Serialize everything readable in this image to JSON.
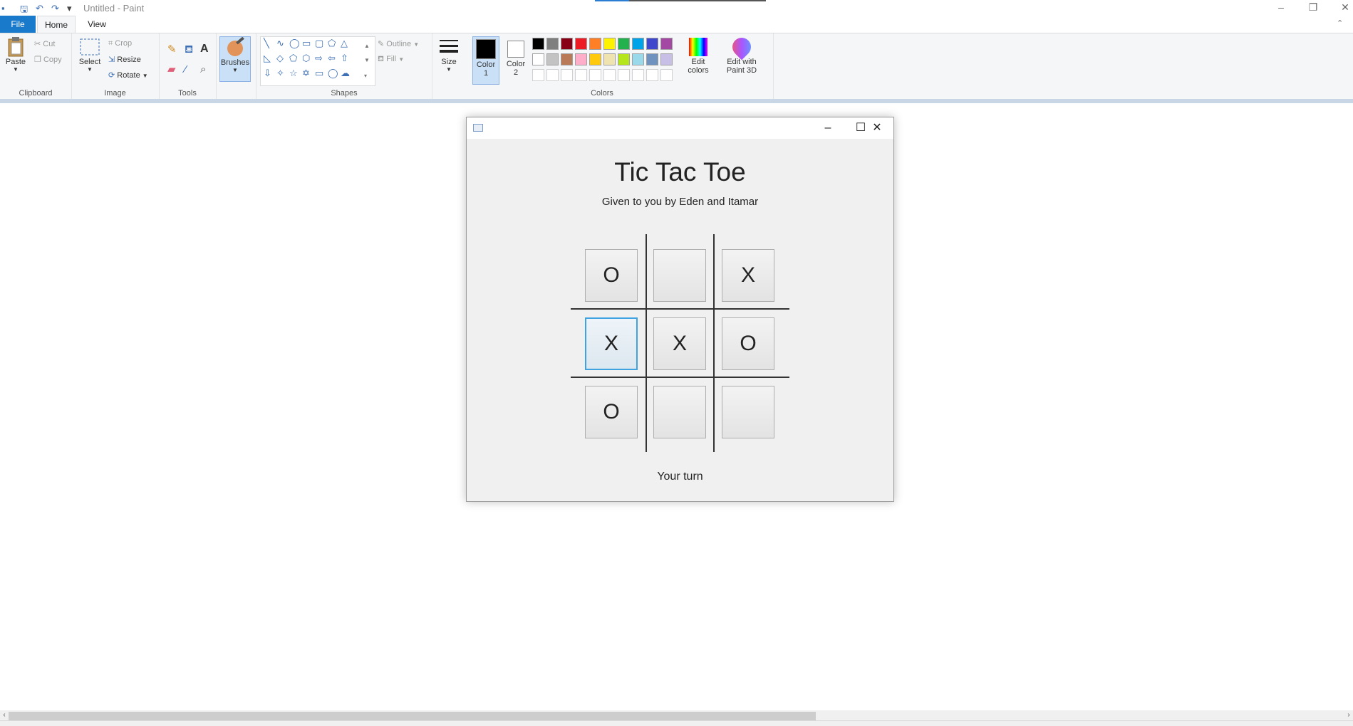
{
  "window": {
    "title": "Untitled - Paint"
  },
  "tabs": {
    "file": "File",
    "home": "Home",
    "view": "View"
  },
  "clipboard": {
    "paste": "Paste",
    "cut": "Cut",
    "copy": "Copy",
    "label": "Clipboard"
  },
  "image": {
    "select": "Select",
    "crop": "Crop",
    "resize": "Resize",
    "rotate": "Rotate",
    "label": "Image"
  },
  "tools": {
    "label": "Tools"
  },
  "brushes": {
    "label": "Brushes"
  },
  "shapes": {
    "outline": "Outline",
    "fill": "Fill",
    "label": "Shapes"
  },
  "size": {
    "label": "Size"
  },
  "colors": {
    "color1": "Color 1",
    "color2": "Color 2",
    "edit": "Edit colors",
    "paint3d": "Edit with Paint 3D",
    "label": "Colors",
    "row1": [
      "#000000",
      "#7f7f7f",
      "#880015",
      "#ed1c24",
      "#ff7f27",
      "#fff200",
      "#22b14c",
      "#00a2e8",
      "#3f48cc",
      "#a349a4"
    ],
    "row2": [
      "#ffffff",
      "#c3c3c3",
      "#b97a57",
      "#ffaec9",
      "#ffc90e",
      "#efe4b0",
      "#b5e61d",
      "#99d9ea",
      "#7092be",
      "#c8bfe7"
    ],
    "row3": [
      "#ffffff",
      "#ffffff",
      "#ffffff",
      "#ffffff",
      "#ffffff",
      "#ffffff",
      "#ffffff",
      "#ffffff",
      "#ffffff",
      "#ffffff"
    ],
    "primary": "#000000",
    "secondary": "#ffffff"
  },
  "game": {
    "title": "Tic Tac Toe",
    "subtitle": "Given to you by Eden and Itamar",
    "board": [
      "O",
      "",
      "X",
      "X",
      "X",
      "O",
      "O",
      "",
      ""
    ],
    "focused_cell": 3,
    "status": "Your turn"
  }
}
